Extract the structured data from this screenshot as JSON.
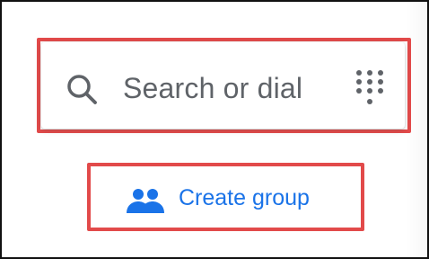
{
  "search": {
    "placeholder": "Search or dial",
    "icon": "search-icon",
    "action_icon": "dialpad-icon"
  },
  "create_group": {
    "label": "Create group",
    "icon": "group-icon"
  },
  "colors": {
    "highlight": "#e24a4a",
    "text_muted": "#5f6368",
    "accent": "#1a73e8",
    "frame": "#111111"
  }
}
